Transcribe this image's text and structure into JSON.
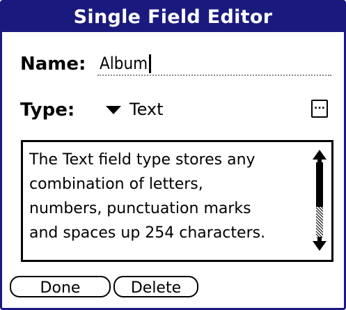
{
  "dialog": {
    "title": "Single Field Editor"
  },
  "name_field": {
    "label": "Name:",
    "value": "Album"
  },
  "type_field": {
    "label": "Type:",
    "selected": "Text",
    "details_button": "..."
  },
  "description": {
    "text": "The Text field type stores any\ncombination of letters,\nnumbers, punctuation marks\nand spaces up 254 characters."
  },
  "buttons": {
    "done": "Done",
    "delete": "Delete"
  },
  "icons": {
    "dropdown": "triangle-down-icon",
    "scroll_up": "arrow-up-icon",
    "scroll_down": "arrow-down-icon"
  },
  "colors": {
    "accent": "#1a1a7e",
    "title_text": "#ffffff",
    "field_underline": "#8a8a8a"
  }
}
